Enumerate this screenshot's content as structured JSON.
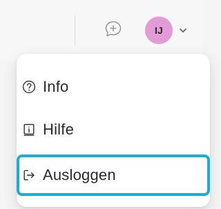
{
  "header": {
    "chat_icon": "chat-plus-icon",
    "avatar": {
      "initials": "IJ",
      "bg_color": "#e39bd8"
    },
    "dropdown_icon": "chevron-down-icon"
  },
  "menu": {
    "items": [
      {
        "label": "Info",
        "icon": "question-circle-icon"
      },
      {
        "label": "Hilfe",
        "icon": "info-doc-icon"
      },
      {
        "label": "Ausloggen",
        "icon": "logout-icon",
        "focused": true
      }
    ],
    "focus_color": "#1aaed6"
  }
}
